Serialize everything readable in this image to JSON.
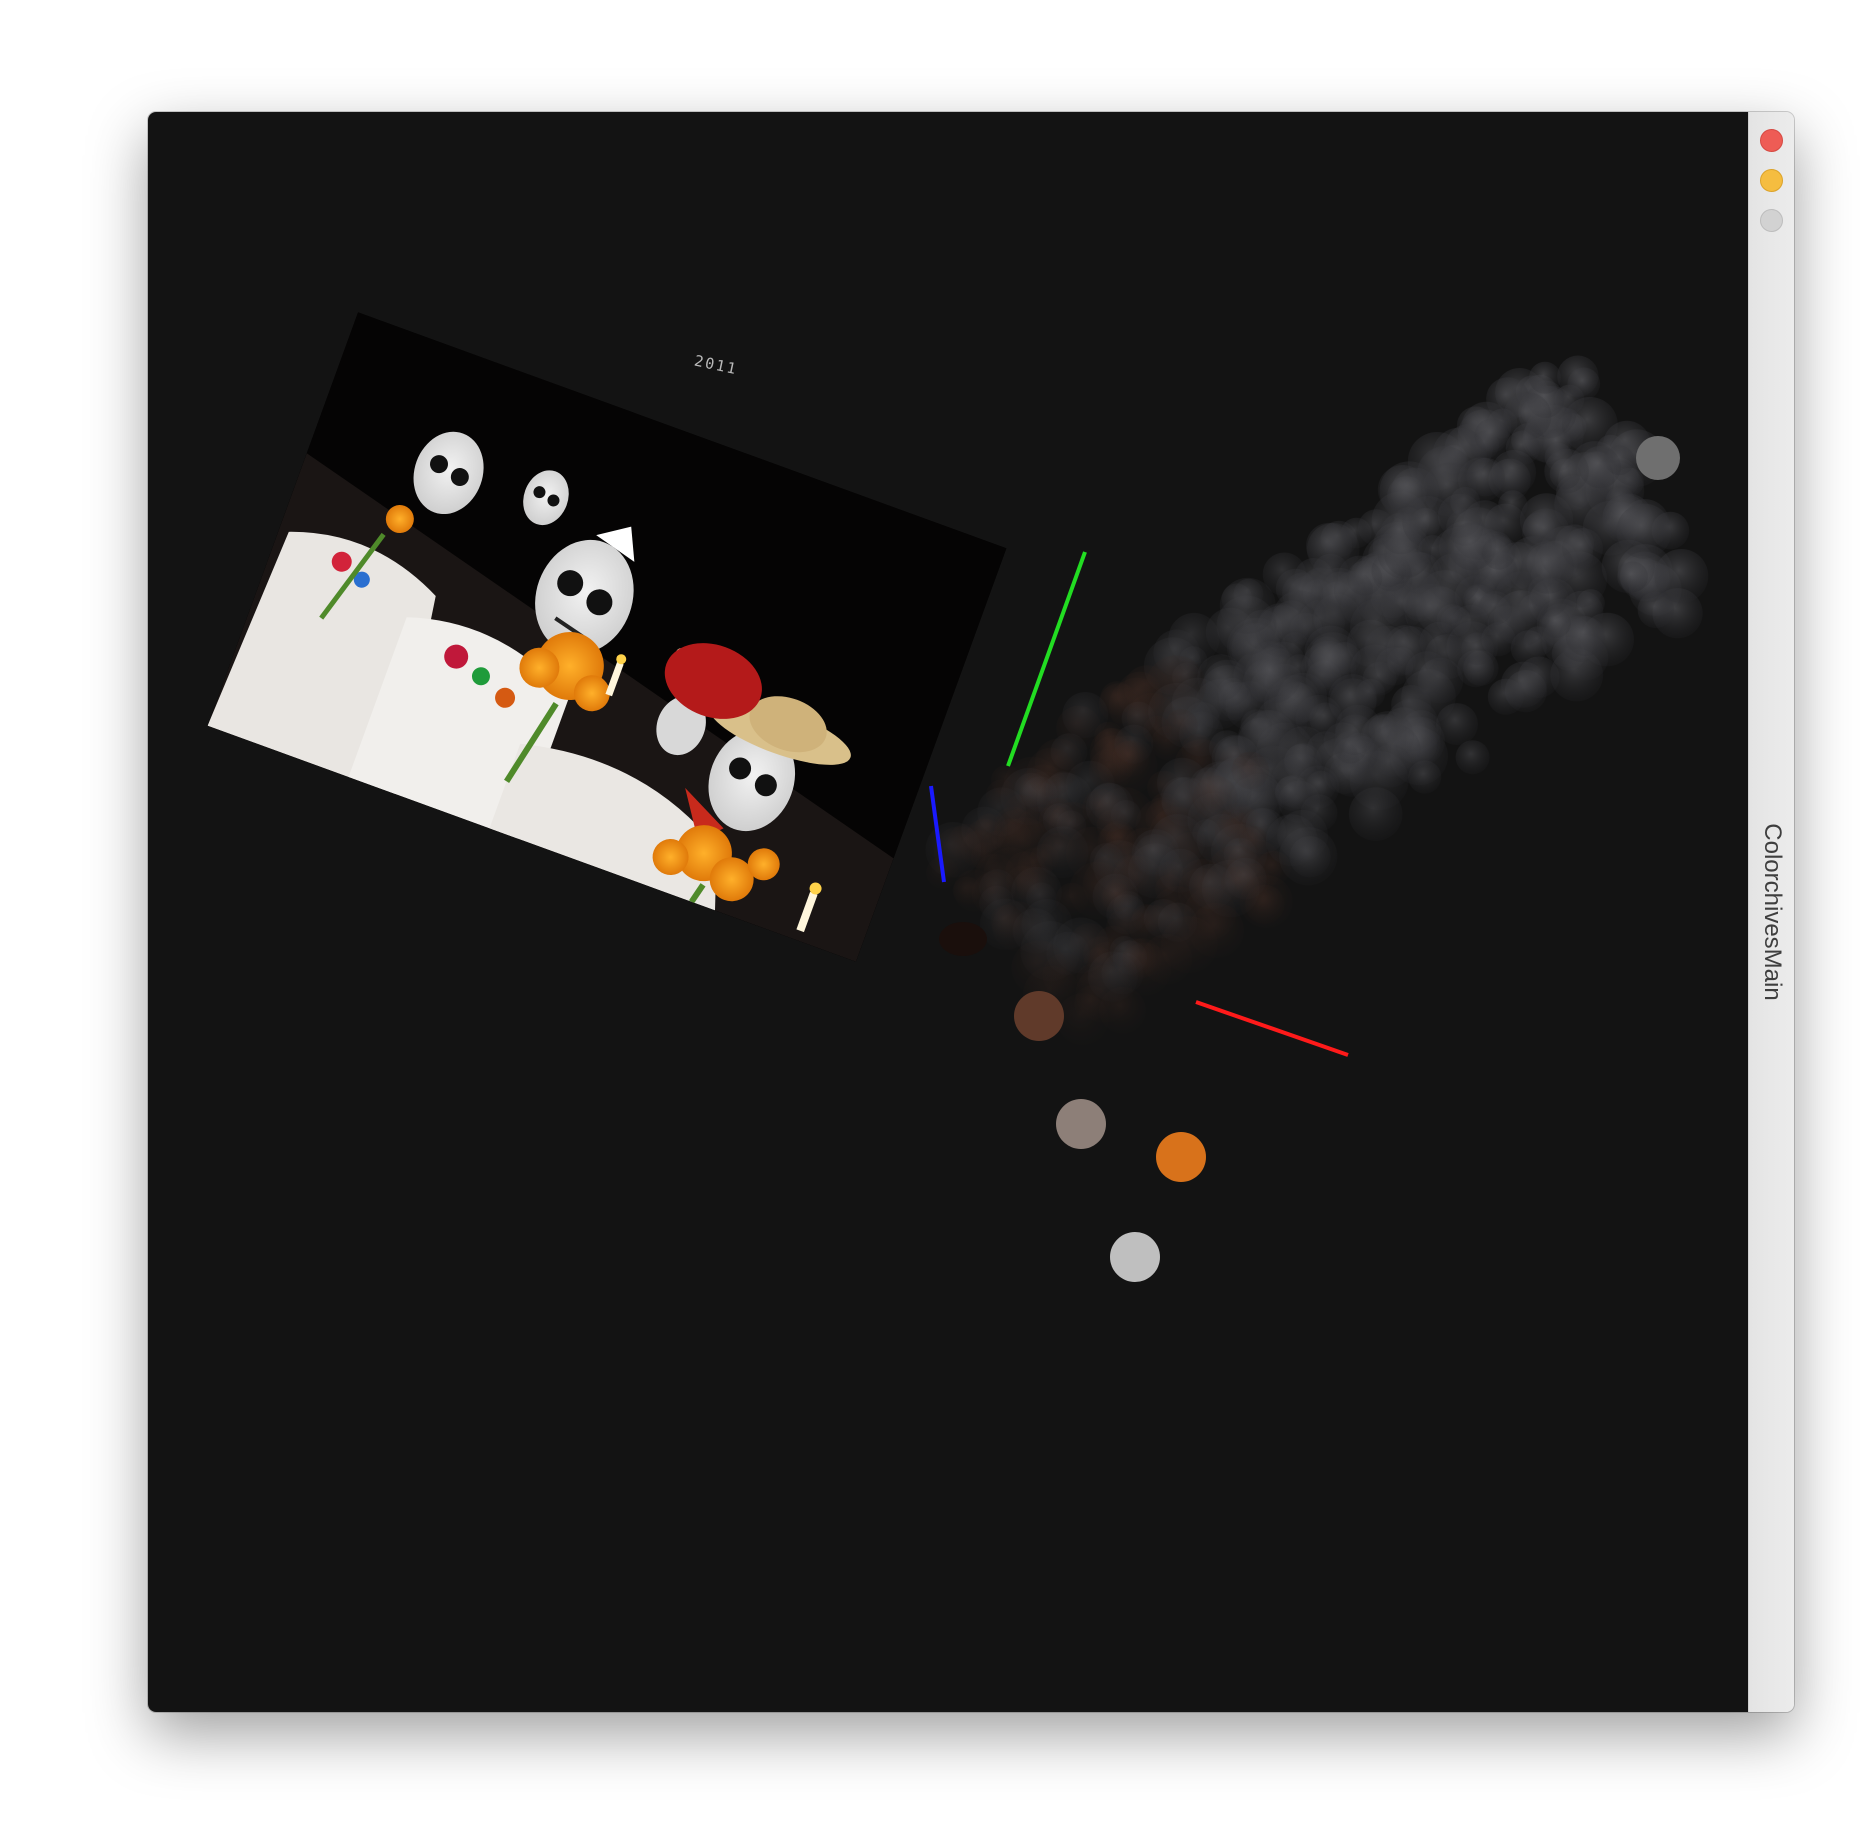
{
  "window": {
    "title": "ColorchivesMain",
    "controls": {
      "close": "close-button",
      "minimize": "minimize-button",
      "zoom": "zoom-button"
    }
  },
  "canvas": {
    "background_color": "#131313",
    "photo": {
      "subject": "Day of the Dead procession photograph",
      "year_label": "2011"
    },
    "axes": {
      "x_color": "#ff1a1a",
      "y_color": "#22dd22",
      "z_color": "#1a1aff"
    },
    "swatches": [
      {
        "name": "swatch-brown",
        "color": "#603a2a"
      },
      {
        "name": "swatch-taupe",
        "color": "#8d7f78"
      },
      {
        "name": "swatch-orange",
        "color": "#d8721b"
      },
      {
        "name": "swatch-light-gray",
        "color": "#bfbfbf"
      }
    ]
  }
}
